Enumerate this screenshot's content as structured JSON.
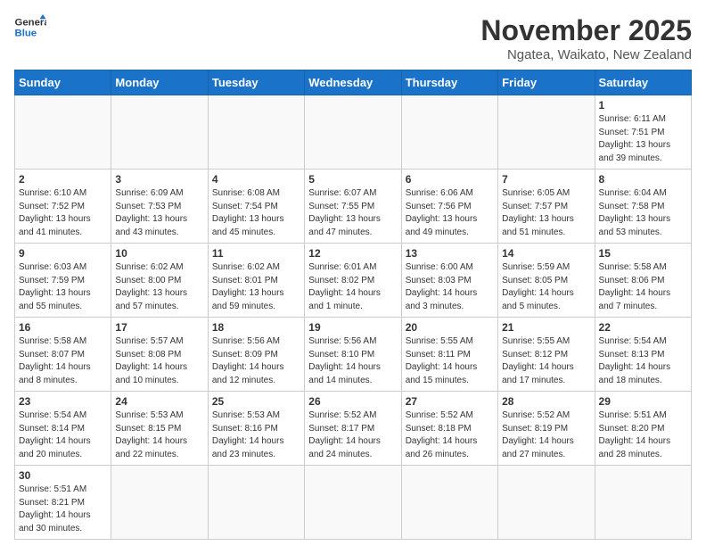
{
  "header": {
    "logo_general": "General",
    "logo_blue": "Blue",
    "month_title": "November 2025",
    "location": "Ngatea, Waikato, New Zealand"
  },
  "days_of_week": [
    "Sunday",
    "Monday",
    "Tuesday",
    "Wednesday",
    "Thursday",
    "Friday",
    "Saturday"
  ],
  "weeks": [
    [
      {
        "day": "",
        "info": ""
      },
      {
        "day": "",
        "info": ""
      },
      {
        "day": "",
        "info": ""
      },
      {
        "day": "",
        "info": ""
      },
      {
        "day": "",
        "info": ""
      },
      {
        "day": "",
        "info": ""
      },
      {
        "day": "1",
        "info": "Sunrise: 6:11 AM\nSunset: 7:51 PM\nDaylight: 13 hours and 39 minutes."
      }
    ],
    [
      {
        "day": "2",
        "info": "Sunrise: 6:10 AM\nSunset: 7:52 PM\nDaylight: 13 hours and 41 minutes."
      },
      {
        "day": "3",
        "info": "Sunrise: 6:09 AM\nSunset: 7:53 PM\nDaylight: 13 hours and 43 minutes."
      },
      {
        "day": "4",
        "info": "Sunrise: 6:08 AM\nSunset: 7:54 PM\nDaylight: 13 hours and 45 minutes."
      },
      {
        "day": "5",
        "info": "Sunrise: 6:07 AM\nSunset: 7:55 PM\nDaylight: 13 hours and 47 minutes."
      },
      {
        "day": "6",
        "info": "Sunrise: 6:06 AM\nSunset: 7:56 PM\nDaylight: 13 hours and 49 minutes."
      },
      {
        "day": "7",
        "info": "Sunrise: 6:05 AM\nSunset: 7:57 PM\nDaylight: 13 hours and 51 minutes."
      },
      {
        "day": "8",
        "info": "Sunrise: 6:04 AM\nSunset: 7:58 PM\nDaylight: 13 hours and 53 minutes."
      }
    ],
    [
      {
        "day": "9",
        "info": "Sunrise: 6:03 AM\nSunset: 7:59 PM\nDaylight: 13 hours and 55 minutes."
      },
      {
        "day": "10",
        "info": "Sunrise: 6:02 AM\nSunset: 8:00 PM\nDaylight: 13 hours and 57 minutes."
      },
      {
        "day": "11",
        "info": "Sunrise: 6:02 AM\nSunset: 8:01 PM\nDaylight: 13 hours and 59 minutes."
      },
      {
        "day": "12",
        "info": "Sunrise: 6:01 AM\nSunset: 8:02 PM\nDaylight: 14 hours and 1 minute."
      },
      {
        "day": "13",
        "info": "Sunrise: 6:00 AM\nSunset: 8:03 PM\nDaylight: 14 hours and 3 minutes."
      },
      {
        "day": "14",
        "info": "Sunrise: 5:59 AM\nSunset: 8:05 PM\nDaylight: 14 hours and 5 minutes."
      },
      {
        "day": "15",
        "info": "Sunrise: 5:58 AM\nSunset: 8:06 PM\nDaylight: 14 hours and 7 minutes."
      }
    ],
    [
      {
        "day": "16",
        "info": "Sunrise: 5:58 AM\nSunset: 8:07 PM\nDaylight: 14 hours and 8 minutes."
      },
      {
        "day": "17",
        "info": "Sunrise: 5:57 AM\nSunset: 8:08 PM\nDaylight: 14 hours and 10 minutes."
      },
      {
        "day": "18",
        "info": "Sunrise: 5:56 AM\nSunset: 8:09 PM\nDaylight: 14 hours and 12 minutes."
      },
      {
        "day": "19",
        "info": "Sunrise: 5:56 AM\nSunset: 8:10 PM\nDaylight: 14 hours and 14 minutes."
      },
      {
        "day": "20",
        "info": "Sunrise: 5:55 AM\nSunset: 8:11 PM\nDaylight: 14 hours and 15 minutes."
      },
      {
        "day": "21",
        "info": "Sunrise: 5:55 AM\nSunset: 8:12 PM\nDaylight: 14 hours and 17 minutes."
      },
      {
        "day": "22",
        "info": "Sunrise: 5:54 AM\nSunset: 8:13 PM\nDaylight: 14 hours and 18 minutes."
      }
    ],
    [
      {
        "day": "23",
        "info": "Sunrise: 5:54 AM\nSunset: 8:14 PM\nDaylight: 14 hours and 20 minutes."
      },
      {
        "day": "24",
        "info": "Sunrise: 5:53 AM\nSunset: 8:15 PM\nDaylight: 14 hours and 22 minutes."
      },
      {
        "day": "25",
        "info": "Sunrise: 5:53 AM\nSunset: 8:16 PM\nDaylight: 14 hours and 23 minutes."
      },
      {
        "day": "26",
        "info": "Sunrise: 5:52 AM\nSunset: 8:17 PM\nDaylight: 14 hours and 24 minutes."
      },
      {
        "day": "27",
        "info": "Sunrise: 5:52 AM\nSunset: 8:18 PM\nDaylight: 14 hours and 26 minutes."
      },
      {
        "day": "28",
        "info": "Sunrise: 5:52 AM\nSunset: 8:19 PM\nDaylight: 14 hours and 27 minutes."
      },
      {
        "day": "29",
        "info": "Sunrise: 5:51 AM\nSunset: 8:20 PM\nDaylight: 14 hours and 28 minutes."
      }
    ],
    [
      {
        "day": "30",
        "info": "Sunrise: 5:51 AM\nSunset: 8:21 PM\nDaylight: 14 hours and 30 minutes."
      },
      {
        "day": "",
        "info": ""
      },
      {
        "day": "",
        "info": ""
      },
      {
        "day": "",
        "info": ""
      },
      {
        "day": "",
        "info": ""
      },
      {
        "day": "",
        "info": ""
      },
      {
        "day": "",
        "info": ""
      }
    ]
  ]
}
